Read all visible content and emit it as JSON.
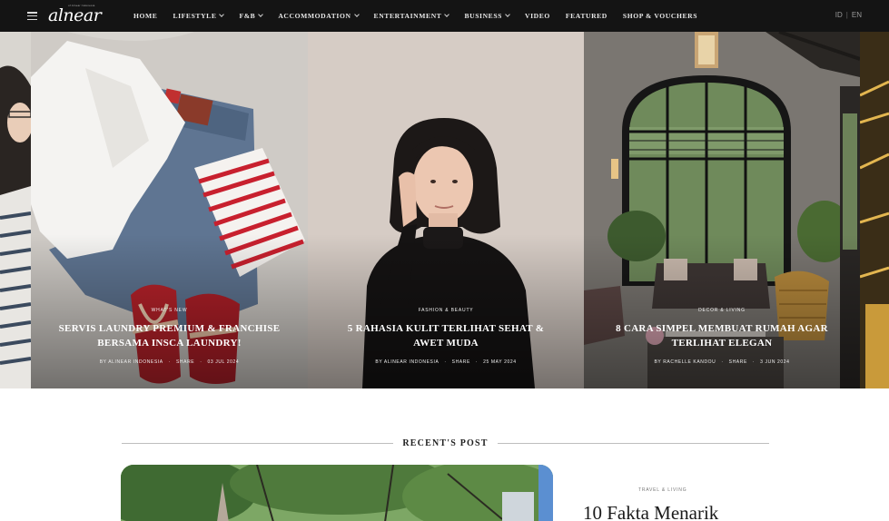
{
  "nav": {
    "logo_text": "alnear",
    "logo_tagline": "of Alnear Indonesia",
    "menu": [
      {
        "label": "HOME",
        "dropdown": false
      },
      {
        "label": "LIFESTYLE",
        "dropdown": true
      },
      {
        "label": "F&B",
        "dropdown": true
      },
      {
        "label": "ACCOMMODATION",
        "dropdown": true
      },
      {
        "label": "ENTERTAINMENT",
        "dropdown": true
      },
      {
        "label": "BUSINESS",
        "dropdown": true
      },
      {
        "label": "VIDEO",
        "dropdown": false
      },
      {
        "label": "FEATURED",
        "dropdown": false
      },
      {
        "label": "SHOP & VOUCHERS",
        "dropdown": false
      }
    ],
    "lang_id": "ID",
    "lang_sep": "|",
    "lang_en": "EN"
  },
  "hero": {
    "slides": [
      {
        "category": "WHAT'S NEW",
        "title": "SERVIS LAUNDRY PREMIUM & FRANCHISE BERSAMA INSCA LAUNDRY!",
        "author": "BY ALINEAR INDONESIA",
        "share": "SHARE",
        "date": "03 JUL 2024"
      },
      {
        "category": "FASHION & BEAUTY",
        "title": "5 RAHASIA KULIT TERLIHAT SEHAT & AWET MUDA",
        "author": "BY ALINEAR INDONESIA",
        "share": "SHARE",
        "date": "25 MAY 2024"
      },
      {
        "category": "DECOR & LIVING",
        "title": "8 CARA SIMPEL MEMBUAT RUMAH AGAR TERLIHAT ELEGAN",
        "author": "BY RACHELLE KANDOU",
        "share": "SHARE",
        "date": "3 JUN 2024"
      }
    ]
  },
  "recent": {
    "heading": "RECENT'S POST",
    "first_post": {
      "category": "TRAVEL & LIVING",
      "title": "10 Fakta Menarik"
    }
  }
}
